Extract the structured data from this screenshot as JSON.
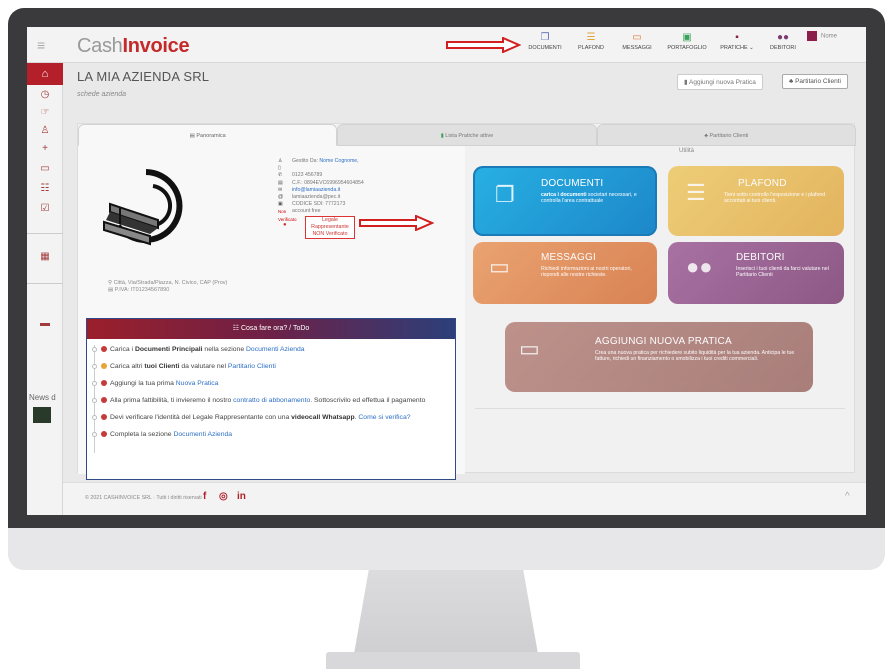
{
  "app": {
    "logo_light": "Cash",
    "logo_bold": "Invoice"
  },
  "nav": {
    "items": [
      {
        "label": "DOCUMENTI",
        "icon": "document-icon"
      },
      {
        "label": "PLAFOND",
        "icon": "list-icon"
      },
      {
        "label": "MESSAGGI",
        "icon": "chat-icon"
      },
      {
        "label": "PORTAFOGLIO",
        "icon": "wallet-icon"
      },
      {
        "label": "PRATICHE",
        "icon": "folder-icon"
      },
      {
        "label": "DEBITORI",
        "icon": "users-icon"
      }
    ],
    "user_label": "Nome"
  },
  "company": {
    "name": "LA MIA AZIENDA SRL",
    "subtitle": "schede azienda"
  },
  "header_buttons": {
    "add_practice": "Aggiungi nuova Pratica",
    "ledger": "Partitario Clienti"
  },
  "tabs": [
    "Panoramica",
    "Lista Pratiche attive",
    "Partitario Clienti"
  ],
  "info": {
    "managed_by_label": "Gestito Da:",
    "managed_by_name": "Nome Cognome,",
    "phone": "0123 456789",
    "cf": "C.F.: 0894EVC6996954604854",
    "email": "info@lamiaazienda.it",
    "pec": "lamiaazienda@pec.it",
    "sdi": "CODICE SDI: 7772173",
    "non_verified_label": "Non Verificato",
    "account": "account free",
    "legal_rep_line1": "Legale Rappresentante",
    "legal_rep_line2": "NON Verificato"
  },
  "address": {
    "line1": "Città, Via/Strada/Piazza, N. Civico, CAP (Prov)",
    "line2": "P.IVA: IT01234567890"
  },
  "todo": {
    "title": "Cosa fare ora? / ToDo",
    "items": [
      {
        "pre": "Carica i ",
        "bold": "Documenti Principali",
        "post": " nella sezione",
        "link": "Documenti Azienda"
      },
      {
        "pre": "Carica altri ",
        "bold": "tuoi Clienti",
        "post": " da valutare nel",
        "link": "Partitario Clienti"
      },
      {
        "pre": "Aggiungi la tua prima",
        "bold": "",
        "post": "",
        "link": "Nuova Pratica"
      },
      {
        "pre": "Alla prima fattibilità, ti invieremo il nostro ",
        "bold": "",
        "post": "",
        "link": "contratto di abbonamento",
        "post2": ". Sottoscrivilo ed effettua il pagamento"
      },
      {
        "pre": "Devi verificare l'identità del Legale Rappresentante con una ",
        "bold": "videocall Whatsapp",
        "post": ".",
        "link": "Come si verifica?"
      },
      {
        "pre": "Completa la sezione",
        "bold": "",
        "post": "",
        "link": "Documenti Azienda"
      }
    ]
  },
  "utilities": {
    "label": "Utilità",
    "documenti": {
      "title": "DOCUMENTI",
      "desc_bold": "carica i documenti",
      "desc": " societari necessari, e controlla l'area contrattuale"
    },
    "plafond": {
      "title": "PLAFOND",
      "desc": "Tieni sotto controllo l'esposizione e i plafond accordati ai tuoi clienti."
    },
    "messaggi": {
      "title": "MESSAGGI",
      "desc": "Richiedi informazioni ai nostri operatori, rispondi alle nostre richieste."
    },
    "debitori": {
      "title": "DEBITORI",
      "desc": "Inserisci i tuoi clienti da farci valutare nel Partitario Clienti"
    },
    "aggiungi": {
      "title": "AGGIUNGI NUOVA PRATICA",
      "desc": "Crea una nuova pratica per richiedere subito liquidità per la tua azienda. Anticipa le tue fatture, richiedi un finanziamento o smobilizza i tuoi crediti commerciali."
    }
  },
  "sidebar": {
    "news_label": "News d"
  },
  "footer": {
    "copyright": "© 2021 CASHINVOICE SRL · Tutti i diritti riservati"
  },
  "colors": {
    "brand": "#c52a2a",
    "documenti": "#27b0e3",
    "plafond": "#eec55a",
    "messaggi": "#e9965b",
    "debitori": "#9c5c96",
    "aggiungi": "#b5827a"
  }
}
